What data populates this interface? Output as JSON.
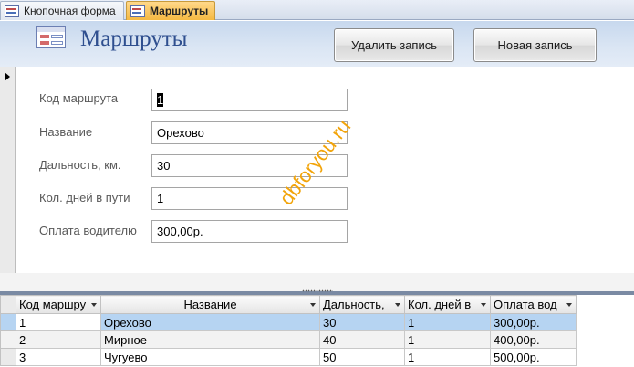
{
  "tabs": [
    {
      "label": "Кнопочная форма",
      "active": false
    },
    {
      "label": "Маршруты",
      "active": true
    }
  ],
  "header": {
    "title": "Маршруты",
    "delete_label": "Удалить запись",
    "new_label": "Новая запись"
  },
  "form": {
    "route_code": {
      "label": "Код маршрута",
      "value": "1"
    },
    "name": {
      "label": "Название",
      "value": "Орехово"
    },
    "distance": {
      "label": "Дальность, км.",
      "value": "30"
    },
    "days": {
      "label": "Кол. дней в пути",
      "value": "1"
    },
    "payment": {
      "label": "Оплата водителю",
      "value": "300,00р."
    }
  },
  "watermark": "dbforyou.ru",
  "datasheet": {
    "columns": [
      "Код маршру",
      "Название",
      "Дальность,",
      "Кол. дней в",
      "Оплата вод"
    ],
    "rows": [
      [
        "1",
        "Орехово",
        "30",
        "1",
        "300,00р."
      ],
      [
        "2",
        "Мирное",
        "40",
        "1",
        "400,00р."
      ],
      [
        "3",
        "Чугуево",
        "50",
        "1",
        "500,00р."
      ]
    ]
  },
  "colors": {
    "accent": "#f5b942",
    "title": "#2f4f8f",
    "selected_row": "#b6d4f2"
  }
}
